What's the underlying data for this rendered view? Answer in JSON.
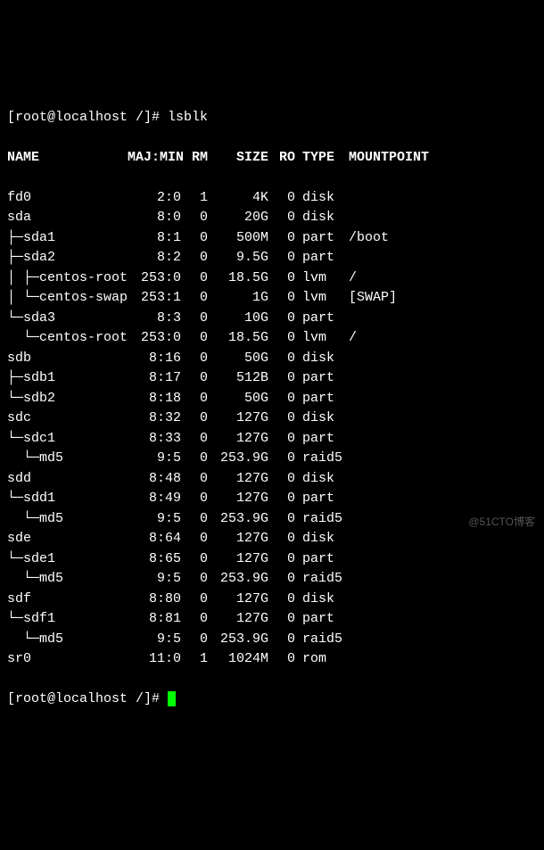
{
  "prompt": "[root@localhost /]# ",
  "command": "lsblk",
  "headers": {
    "name": "NAME",
    "majmin": "MAJ:MIN",
    "rm": "RM",
    "size": "SIZE",
    "ro": "RO",
    "type": "TYPE",
    "mountpoint": "MOUNTPOINT"
  },
  "rows": [
    {
      "name": "fd0",
      "majmin": "2:0",
      "rm": "1",
      "size": "4K",
      "ro": "0",
      "type": "disk",
      "mount": ""
    },
    {
      "name": "sda",
      "majmin": "8:0",
      "rm": "0",
      "size": "20G",
      "ro": "0",
      "type": "disk",
      "mount": ""
    },
    {
      "name": "├─sda1",
      "majmin": "8:1",
      "rm": "0",
      "size": "500M",
      "ro": "0",
      "type": "part",
      "mount": "/boot"
    },
    {
      "name": "├─sda2",
      "majmin": "8:2",
      "rm": "0",
      "size": "9.5G",
      "ro": "0",
      "type": "part",
      "mount": ""
    },
    {
      "name": "│ ├─centos-root",
      "majmin": "253:0",
      "rm": "0",
      "size": "18.5G",
      "ro": "0",
      "type": "lvm",
      "mount": "/"
    },
    {
      "name": "│ └─centos-swap",
      "majmin": "253:1",
      "rm": "0",
      "size": "1G",
      "ro": "0",
      "type": "lvm",
      "mount": "[SWAP]"
    },
    {
      "name": "└─sda3",
      "majmin": "8:3",
      "rm": "0",
      "size": "10G",
      "ro": "0",
      "type": "part",
      "mount": ""
    },
    {
      "name": "  └─centos-root",
      "majmin": "253:0",
      "rm": "0",
      "size": "18.5G",
      "ro": "0",
      "type": "lvm",
      "mount": "/"
    },
    {
      "name": "sdb",
      "majmin": "8:16",
      "rm": "0",
      "size": "50G",
      "ro": "0",
      "type": "disk",
      "mount": ""
    },
    {
      "name": "├─sdb1",
      "majmin": "8:17",
      "rm": "0",
      "size": "512B",
      "ro": "0",
      "type": "part",
      "mount": ""
    },
    {
      "name": "└─sdb2",
      "majmin": "8:18",
      "rm": "0",
      "size": "50G",
      "ro": "0",
      "type": "part",
      "mount": ""
    },
    {
      "name": "sdc",
      "majmin": "8:32",
      "rm": "0",
      "size": "127G",
      "ro": "0",
      "type": "disk",
      "mount": ""
    },
    {
      "name": "└─sdc1",
      "majmin": "8:33",
      "rm": "0",
      "size": "127G",
      "ro": "0",
      "type": "part",
      "mount": ""
    },
    {
      "name": "  └─md5",
      "majmin": "9:5",
      "rm": "0",
      "size": "253.9G",
      "ro": "0",
      "type": "raid5",
      "mount": ""
    },
    {
      "name": "sdd",
      "majmin": "8:48",
      "rm": "0",
      "size": "127G",
      "ro": "0",
      "type": "disk",
      "mount": ""
    },
    {
      "name": "└─sdd1",
      "majmin": "8:49",
      "rm": "0",
      "size": "127G",
      "ro": "0",
      "type": "part",
      "mount": ""
    },
    {
      "name": "  └─md5",
      "majmin": "9:5",
      "rm": "0",
      "size": "253.9G",
      "ro": "0",
      "type": "raid5",
      "mount": ""
    },
    {
      "name": "sde",
      "majmin": "8:64",
      "rm": "0",
      "size": "127G",
      "ro": "0",
      "type": "disk",
      "mount": ""
    },
    {
      "name": "└─sde1",
      "majmin": "8:65",
      "rm": "0",
      "size": "127G",
      "ro": "0",
      "type": "part",
      "mount": ""
    },
    {
      "name": "  └─md5",
      "majmin": "9:5",
      "rm": "0",
      "size": "253.9G",
      "ro": "0",
      "type": "raid5",
      "mount": ""
    },
    {
      "name": "sdf",
      "majmin": "8:80",
      "rm": "0",
      "size": "127G",
      "ro": "0",
      "type": "disk",
      "mount": ""
    },
    {
      "name": "└─sdf1",
      "majmin": "8:81",
      "rm": "0",
      "size": "127G",
      "ro": "0",
      "type": "part",
      "mount": ""
    },
    {
      "name": "  └─md5",
      "majmin": "9:5",
      "rm": "0",
      "size": "253.9G",
      "ro": "0",
      "type": "raid5",
      "mount": ""
    },
    {
      "name": "sr0",
      "majmin": "11:0",
      "rm": "1",
      "size": "1024M",
      "ro": "0",
      "type": "rom",
      "mount": ""
    }
  ],
  "watermark": "@51CTO博客"
}
